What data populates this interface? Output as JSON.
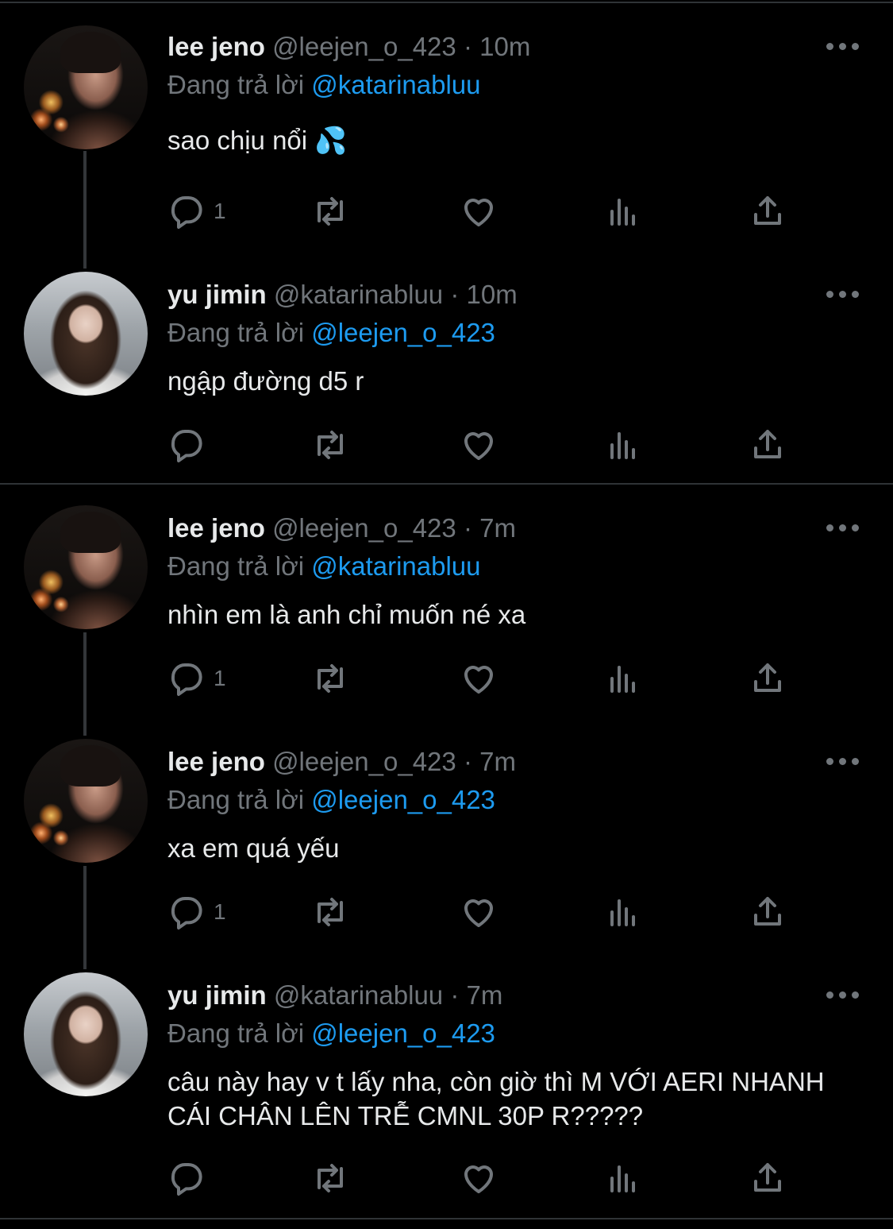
{
  "tweets": [
    {
      "name": "lee jeno",
      "handle": "@leejen_o_423",
      "dot": "·",
      "time": "10m",
      "reply_prefix": "Đang trả lời",
      "reply_to": "@katarinabluu",
      "text": "sao chịu nổi 💦",
      "replies": "1"
    },
    {
      "name": "yu jimin",
      "handle": "@katarinabluu",
      "dot": "·",
      "time": "10m",
      "reply_prefix": "Đang trả lời",
      "reply_to": "@leejen_o_423",
      "text": "ngập đường d5 r",
      "replies": ""
    },
    {
      "name": "lee jeno",
      "handle": "@leejen_o_423",
      "dot": "·",
      "time": "7m",
      "reply_prefix": "Đang trả lời",
      "reply_to": "@katarinabluu",
      "text": "nhìn em là anh chỉ muốn né xa",
      "replies": "1"
    },
    {
      "name": "lee jeno",
      "handle": "@leejen_o_423",
      "dot": "·",
      "time": "7m",
      "reply_prefix": "Đang trả lời",
      "reply_to": "@leejen_o_423",
      "text": "xa em quá yếu",
      "replies": "1"
    },
    {
      "name": "yu jimin",
      "handle": "@katarinabluu",
      "dot": "·",
      "time": "7m",
      "reply_prefix": "Đang trả lời",
      "reply_to": "@leejen_o_423",
      "text": "câu này hay v t lấy nha, còn giờ thì M VỚI AERI NHANH CÁI CHÂN LÊN TRỄ CMNL 30P R?????",
      "replies": ""
    }
  ],
  "icons": {
    "reply": "reply-icon",
    "retweet": "retweet-icon",
    "like": "heart-icon",
    "views": "views-icon",
    "share": "share-icon",
    "more": "more-icon"
  },
  "colors": {
    "background": "#000000",
    "text": "#e7e9ea",
    "muted": "#71767b",
    "mention": "#1d9bf0",
    "divider": "#2f3336"
  }
}
